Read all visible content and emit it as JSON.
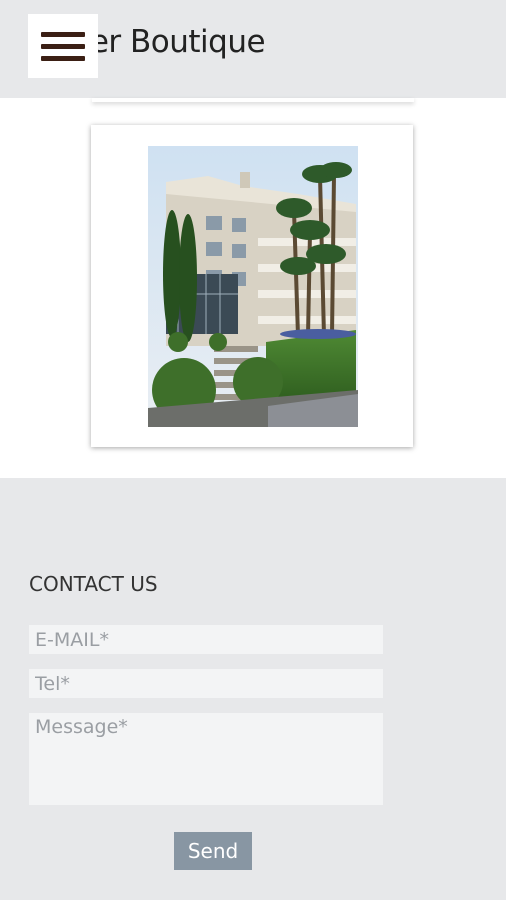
{
  "header": {
    "title": "ver Boutique",
    "menu_icon": "hamburger-icon"
  },
  "gallery": {
    "image_description": "hotel-building-photo"
  },
  "contact": {
    "title": "CONTACT US",
    "email_placeholder": "E-MAIL*",
    "tel_placeholder": "Tel*",
    "message_placeholder": "Message*",
    "send_label": "Send"
  },
  "colors": {
    "background": "#e7e8ea",
    "menu_bar": "#3b1f14",
    "send_button": "#8896a3"
  }
}
